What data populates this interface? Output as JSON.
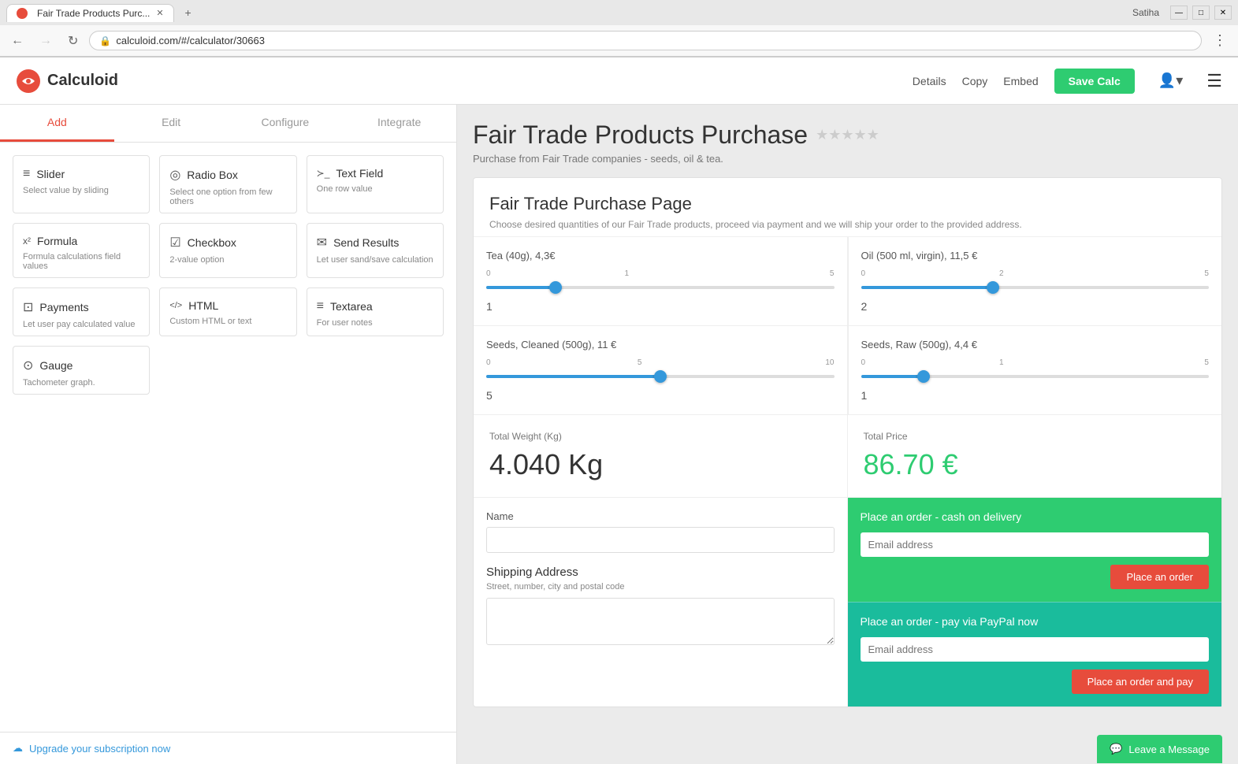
{
  "browser": {
    "tab_title": "Fair Trade Products Purc...",
    "url": "calculoid.com/#/calculator/30663",
    "nav": {
      "back_disabled": false,
      "forward_disabled": true
    },
    "window_controls": {
      "minimize": "—",
      "maximize": "□",
      "close": "✕"
    },
    "user_name": "Satiha"
  },
  "header": {
    "logo_text": "Calculoid",
    "nav_links": [
      "Details",
      "Copy",
      "Embed"
    ],
    "save_btn": "Save Calc"
  },
  "sidebar": {
    "tabs": [
      "Add",
      "Edit",
      "Configure",
      "Integrate"
    ],
    "active_tab": 0,
    "widgets": [
      {
        "icon": "≡",
        "name": "Slider",
        "desc": "Select value by sliding"
      },
      {
        "icon": "◎",
        "name": "Radio Box",
        "desc": "Select one option from few others"
      },
      {
        "icon": ">_",
        "name": "Text Field",
        "desc": "One row value"
      },
      {
        "icon": "x²",
        "name": "Formula",
        "desc": "Formula calculations field values"
      },
      {
        "icon": "☑",
        "name": "Checkbox",
        "desc": "2-value option"
      },
      {
        "icon": "✉",
        "name": "Send Results",
        "desc": "Let user sand/save calculation"
      },
      {
        "icon": "$",
        "name": "Payments",
        "desc": "Let user pay calculated value"
      },
      {
        "icon": "</>",
        "name": "HTML",
        "desc": "Custom HTML or text"
      },
      {
        "icon": "≡",
        "name": "Textarea",
        "desc": "For user notes"
      },
      {
        "icon": "☺",
        "name": "Gauge",
        "desc": "Tachometer graph."
      }
    ],
    "footer_text": "Upgrade your subscription now"
  },
  "calculator": {
    "title": "Fair Trade Products Purchase",
    "subtitle": "Purchase from Fair Trade companies - seeds, oil & tea.",
    "stars_empty": "★★★★★",
    "card_title": "Fair Trade Purchase Page",
    "card_subtitle": "Choose desired quantities of our Fair Trade products, proceed via payment and we will ship your order to the provided address.",
    "sliders": [
      {
        "label": "Tea (40g), 4,3€",
        "min": 0,
        "max": 5,
        "value": 1,
        "tick_labels": [
          "0",
          "",
          "1",
          "",
          "",
          "5"
        ],
        "fill_pct": 20,
        "thumb_pct": 20
      },
      {
        "label": "Oil (500 ml, virgin), 11,5 €",
        "min": 0,
        "max": 5,
        "value": 2,
        "tick_labels": [
          "0",
          "",
          "2",
          "",
          "",
          "5"
        ],
        "fill_pct": 38,
        "thumb_pct": 38
      },
      {
        "label": "Seeds, Cleaned (500g), 11 €",
        "min": 0,
        "max": 10,
        "value": 5,
        "tick_labels": [
          "0",
          "",
          "",
          "",
          "5",
          "",
          "",
          "",
          "",
          "10"
        ],
        "fill_pct": 50,
        "thumb_pct": 50
      },
      {
        "label": "Seeds, Raw (500g), 4,4 €",
        "min": 0,
        "max": 5,
        "value": 1,
        "tick_labels": [
          "0",
          "",
          "1",
          "",
          "",
          "5"
        ],
        "fill_pct": 18,
        "thumb_pct": 18
      }
    ],
    "results": [
      {
        "label": "Total Weight (Kg)",
        "value": "4.040 Kg",
        "green": false
      },
      {
        "label": "Total Price",
        "value": "86.70 €",
        "green": true
      }
    ],
    "name_field": {
      "label": "Name",
      "placeholder": ""
    },
    "shipping_field": {
      "label": "Shipping Address",
      "hint": "Street, number, city and postal code",
      "placeholder": ""
    },
    "payment_cod": {
      "title": "Place an order - cash on delivery",
      "email_placeholder": "Email address",
      "btn_label": "Place an order"
    },
    "payment_paypal": {
      "title": "Place an order - pay via PayPal now",
      "email_placeholder": "Email address",
      "btn_label": "Place an order and pay"
    },
    "leave_message": "Leave a Message"
  }
}
